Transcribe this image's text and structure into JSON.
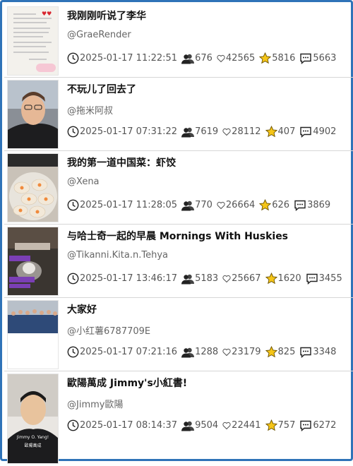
{
  "posts": [
    {
      "title": "我刚刚听说了李华",
      "author": "@GraeRender",
      "time": "2025-01-17 11:22:51",
      "followers": "676",
      "likes": "42565",
      "stars": "5816",
      "comments": "5663"
    },
    {
      "title": "不玩儿了回去了",
      "author": "@拖米阿叔",
      "time": "2025-01-17 07:31:22",
      "followers": "7619",
      "likes": "28112",
      "stars": "407",
      "comments": "4902"
    },
    {
      "title": "我的第一道中国菜：虾饺",
      "author": "@Xena",
      "time": "2025-01-17 11:28:05",
      "followers": "770",
      "likes": "26664",
      "stars": "626",
      "comments": "3869"
    },
    {
      "title": "与哈士奇一起的早晨 Mornings With Huskies",
      "author": "@Tikanni.Kita.n.Tehya",
      "time": "2025-01-17 13:46:17",
      "followers": "5183",
      "likes": "25667",
      "stars": "1620",
      "comments": "3455"
    },
    {
      "title": "大家好",
      "author": "@小红薯6787709E",
      "time": "2025-01-17 07:21:16",
      "followers": "1288",
      "likes": "23179",
      "stars": "825",
      "comments": "3348"
    },
    {
      "title": "歐陽萬成 Jimmy's小紅書!",
      "author": "@Jimmy歐陽",
      "time": "2025-01-17 08:14:37",
      "followers": "9504",
      "likes": "22441",
      "stars": "757",
      "comments": "6272",
      "thumb_caption_1": "Jimmy O. Yang!",
      "thumb_caption_2": "歐陽萬成"
    }
  ],
  "icons": {
    "time": "clock-icon",
    "followers": "people-icon",
    "likes": "heart-icon",
    "stars": "star-icon",
    "comments": "comment-icon"
  },
  "colors": {
    "frame": "#2f73b8",
    "star": "#f5c518"
  }
}
